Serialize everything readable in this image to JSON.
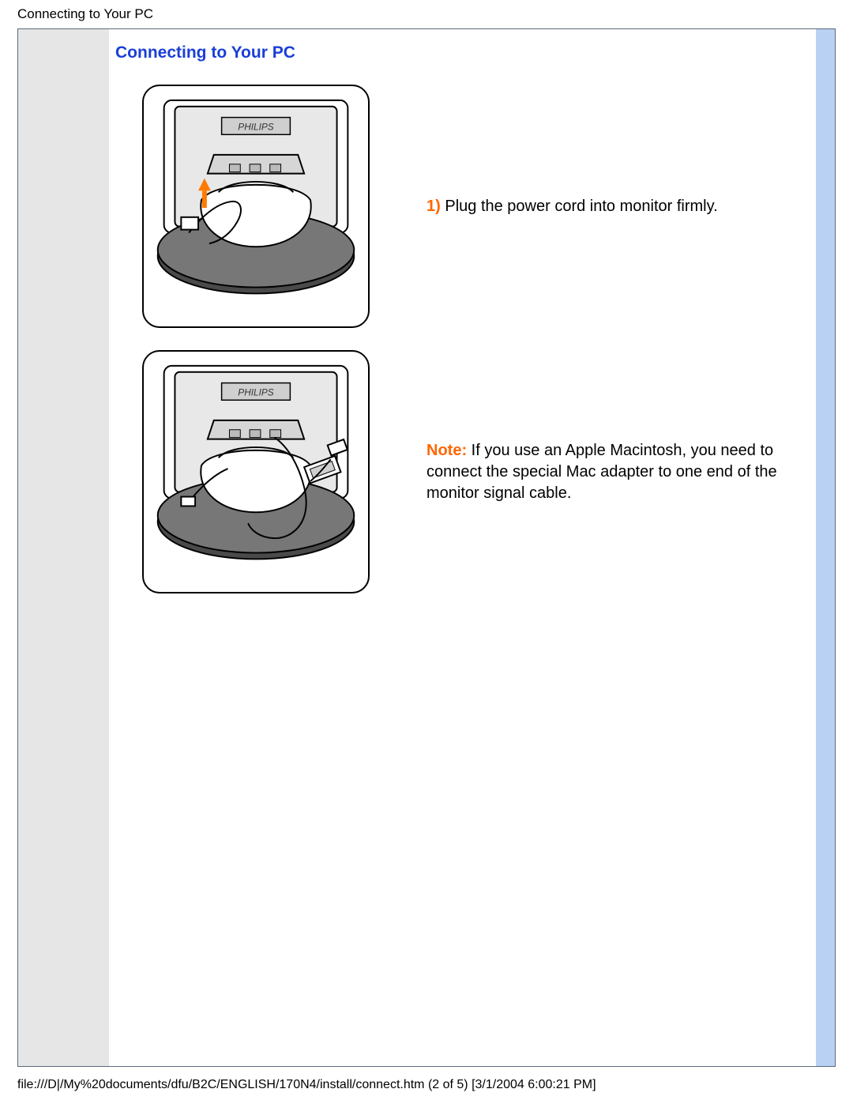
{
  "header": {
    "breadcrumb": "Connecting to Your PC"
  },
  "section": {
    "heading": "Connecting to Your PC"
  },
  "steps": [
    {
      "num_label": "1)",
      "text": " Plug the power cord into monitor firmly."
    },
    {
      "note_label": "Note:",
      "text": " If you use an Apple Macintosh, you need to connect the special Mac adapter to one end of the monitor signal cable."
    }
  ],
  "footer": {
    "path": "file:///D|/My%20documents/dfu/B2C/ENGLISH/170N4/install/connect.htm (2 of 5) [3/1/2004 6:00:21 PM]"
  }
}
